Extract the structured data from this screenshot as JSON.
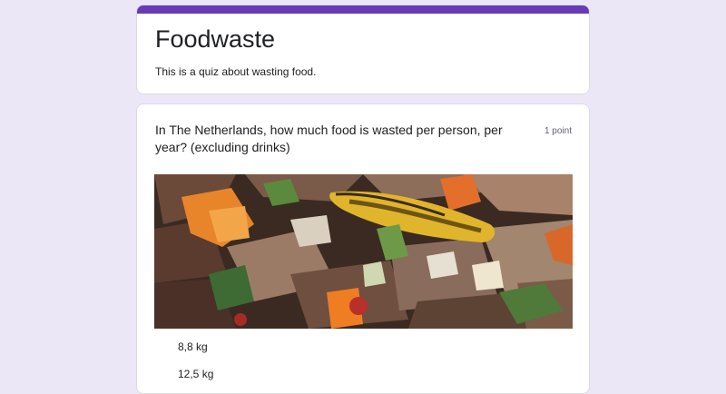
{
  "form": {
    "title": "Foodwaste",
    "description": "This is a quiz about wasting food.",
    "accent_color": "#673ab7",
    "background_color": "#ece7f6"
  },
  "question": {
    "text": "In The Netherlands, how much food is wasted per person, per year? (excluding drinks)",
    "points": "1 point",
    "image_icon": "food-waste-photo",
    "options": [
      {
        "label": "8,8 kg"
      },
      {
        "label": "12,5 kg"
      }
    ]
  }
}
